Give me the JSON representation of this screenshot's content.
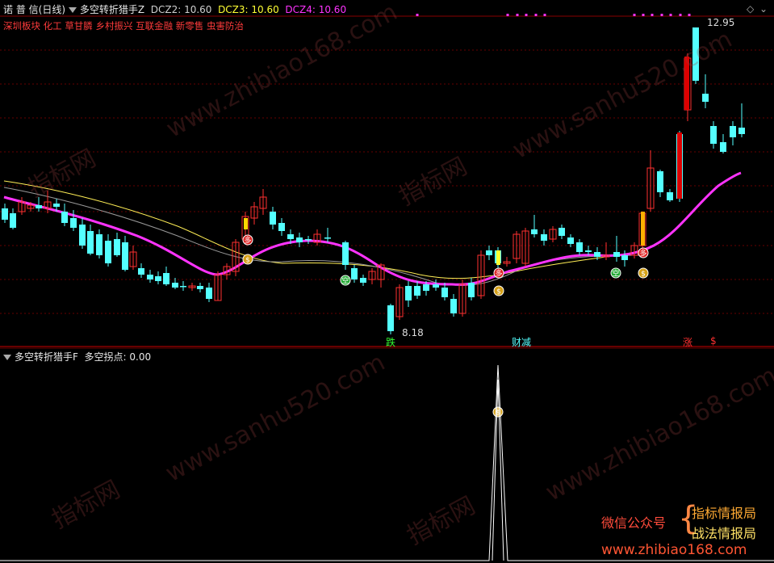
{
  "header": {
    "brand": "诺",
    "period": "普 信(日线)",
    "indicator_name": "多空转折猎手Z",
    "dcz2_label": "DCZ2: 10.60",
    "dcz3_label": "DCZ3: 10.60",
    "dcz4_label": "DCZ4: 10.60"
  },
  "sectors": [
    "深圳板块",
    "化工",
    "草甘膦",
    "乡村振兴",
    "互联金融",
    "新零售",
    "虫害防治"
  ],
  "price_labels": {
    "high": "12.95",
    "low": "8.18"
  },
  "signal_labels": {
    "die": "跌",
    "caijian": "财减",
    "zhang": "涨",
    "money": "$",
    "duo": "多",
    "kong": "空"
  },
  "sub_header": {
    "indicator_name": "多空转折猎手F",
    "value_label": "多空拐点: 0.00"
  },
  "branding": {
    "wechat": "微信公众号",
    "line1": "指标情报局",
    "line2": "战法情报局",
    "site": "www.zhibiao168.com"
  },
  "watermarks": [
    "www.zhibiao168.com",
    "www.sanhu520.com",
    "指标网"
  ],
  "colors": {
    "up": "#ff3030",
    "down": "#54ffff",
    "ma": "#ff33ff",
    "yellow": "#ffff33",
    "gray": "#aaaaaa"
  }
}
